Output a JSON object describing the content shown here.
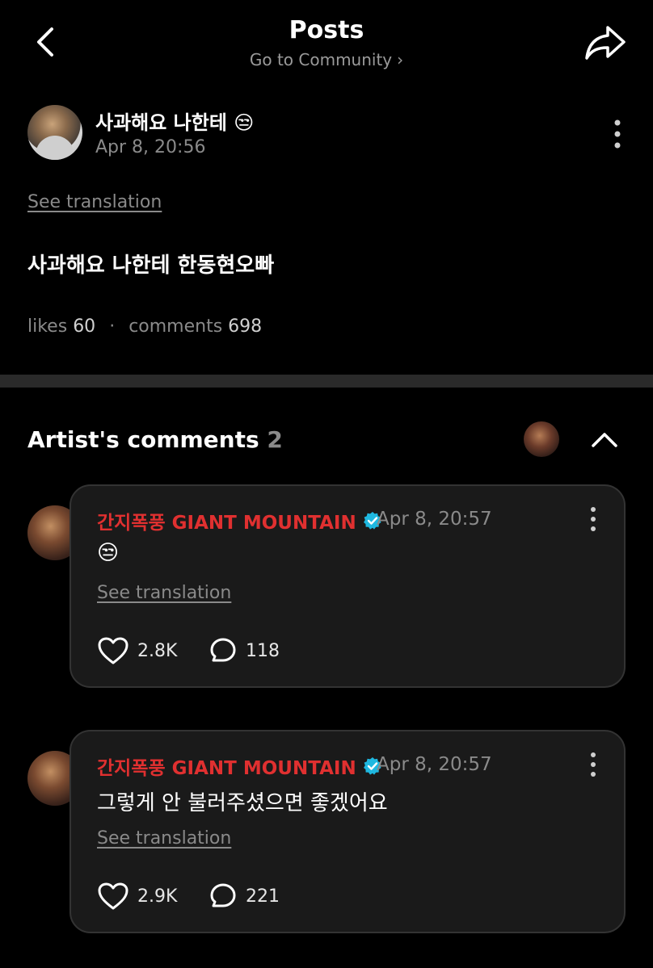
{
  "header": {
    "title": "Posts",
    "subtitle": "Go to Community",
    "back_icon": "chevron-left-icon",
    "share_icon": "share-arrow-icon"
  },
  "post": {
    "author": "사과해요 나한테 😒",
    "time": "Apr 8, 20:56",
    "translate_label": "See translation",
    "body": "사과해요 나한테 한동현오빠",
    "likes_label": "likes",
    "likes_count": "60",
    "comments_label": "comments",
    "comments_count": "698"
  },
  "artist_comments": {
    "title": "Artist's comments",
    "count": "2",
    "items": [
      {
        "author": "간지폭풍 GIANT MOUNTAIN",
        "time": "Apr 8, 20:57",
        "text": "😒",
        "translate_label": "See translation",
        "likes": "2.8K",
        "replies": "118"
      },
      {
        "author": "간지폭풍 GIANT MOUNTAIN",
        "time": "Apr 8, 20:57",
        "text": "그렇게 안 불러주셨으면 좋겠어요",
        "translate_label": "See translation",
        "likes": "2.9K",
        "replies": "221"
      }
    ]
  },
  "colors": {
    "background": "#000000",
    "card": "#1a1a1a",
    "artist_name": "#e03030",
    "verified_badge": "#1fb8e0",
    "muted_text": "#8a8a8a"
  }
}
